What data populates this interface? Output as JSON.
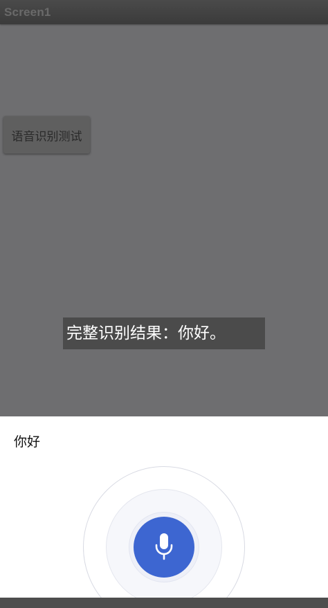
{
  "window": {
    "title": "Screen1"
  },
  "main": {
    "test_button_label": "语音识别测试",
    "result_text": "完整识别结果：你好。"
  },
  "voice_dialog": {
    "partial_text": "你好",
    "mic_icon": "microphone-icon",
    "accent_color": "#3d66d1"
  }
}
